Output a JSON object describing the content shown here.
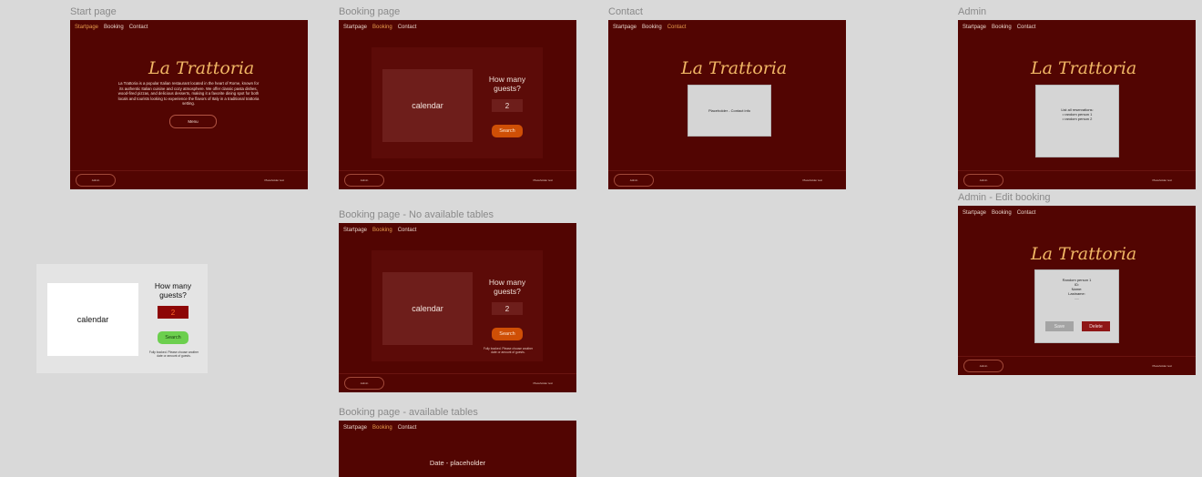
{
  "labels": {
    "start": "Start page",
    "booking": "Booking page",
    "contact": "Contact",
    "admin": "Admin",
    "admin_edit": "Admin - Edit booking",
    "booking_none": "Booking page - No available tables",
    "booking_avail": "Booking page - available tables"
  },
  "nav": {
    "start": "Startpage",
    "booking": "Booking",
    "contact": "Contact"
  },
  "logo": "La Trattoria",
  "start": {
    "intro": "La Trattoria is a popular Italian restaurant located in the heart of Rome, known for its authentic Italian cuisine and cozy atmosphere. We offer classic pasta dishes, wood-fired pizzas, and delicious desserts, making it a favorite dining spot for both locals and tourists looking to experience the flavors of Italy in a traditional trattoria setting.",
    "menu_button": "Menu"
  },
  "footer": {
    "button": "Admin",
    "text": "Placeholder text"
  },
  "booking": {
    "calendar": "calendar",
    "question": "How many guests?",
    "guests": "2",
    "search": "Search",
    "no_tables": "Fully booked. Please choose another date or amount of guests."
  },
  "contact": {
    "placeholder": "Placeholder - Contact info"
  },
  "admin": {
    "heading": "List all reservations:",
    "items": [
      "random person 1",
      "random person 2"
    ]
  },
  "edit": {
    "title": "Random person 1",
    "fields": [
      "ID:",
      "Name:",
      "Lastname:",
      "....."
    ],
    "save": "Save",
    "delete": "Delete"
  },
  "available": {
    "date": "Date - placeholder"
  },
  "colors": {
    "bg": "#520502",
    "accent": "#f1b765",
    "button": "#cf4f06",
    "green": "#6ccf4e"
  }
}
